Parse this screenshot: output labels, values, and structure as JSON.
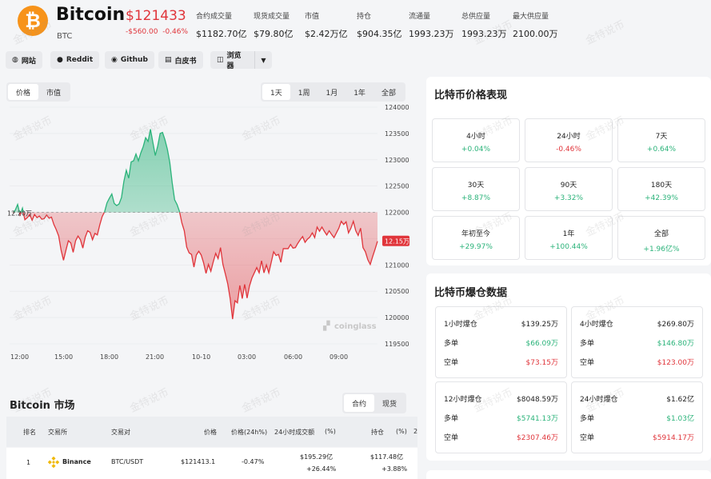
{
  "coin": {
    "logo_glyph": "₿",
    "name": "Bitcoin",
    "symbol": "BTC",
    "price": "$121433",
    "change_abs": "-$560.00",
    "change_pct": "-0.46%"
  },
  "stats": [
    {
      "label": "合约成交量",
      "value": "$1182.70亿"
    },
    {
      "label": "现货成交量",
      "value": "$79.80亿"
    },
    {
      "label": "市值",
      "value": "$2.42万亿"
    },
    {
      "label": "持仓",
      "value": "$904.35亿"
    },
    {
      "label": "流通量",
      "value": "1993.23万"
    },
    {
      "label": "总供应量",
      "value": "1993.23万"
    },
    {
      "label": "最大供应量",
      "value": "2100.00万"
    }
  ],
  "links": [
    {
      "label": "网站",
      "icon": "globe-icon",
      "glyph": "◍"
    },
    {
      "label": "Reddit",
      "icon": "reddit-icon",
      "glyph": "●"
    },
    {
      "label": "Github",
      "icon": "github-icon",
      "glyph": "◉"
    },
    {
      "label": "白皮书",
      "icon": "document-icon",
      "glyph": "▤"
    },
    {
      "label": "浏览器",
      "icon": "browser-icon",
      "glyph": "◫"
    }
  ],
  "chart_tabs": {
    "type_tabs": [
      "价格",
      "市值"
    ],
    "active_type": "价格",
    "range_tabs": [
      "1天",
      "1周",
      "1月",
      "1年",
      "全部"
    ],
    "active_range": "1天"
  },
  "chart_data": {
    "type": "area",
    "title": "",
    "xlabel": "",
    "ylabel": "",
    "x_ticks": [
      "12:00",
      "15:00",
      "18:00",
      "21:00",
      "10-10",
      "03:00",
      "06:00",
      "09:00"
    ],
    "y_ticks": [
      "124000",
      "123500",
      "123000",
      "122500",
      "122000",
      "121500",
      "121000",
      "120500",
      "120000",
      "119500"
    ],
    "ylim": [
      119500,
      124000
    ],
    "baseline": 122000,
    "baseline_label": "12.20万",
    "current_label": "12.15万",
    "watermark": "coinglass",
    "colors": {
      "up": "#2bb37a",
      "down": "#e0353b"
    },
    "series": [
      {
        "values": [
          121990,
          122040,
          122150,
          121950,
          122080,
          121860,
          121900,
          121960,
          121850,
          121960,
          121900,
          121930,
          121870,
          121880,
          121950,
          121890,
          121910,
          121770,
          121670,
          121550,
          121280,
          121090,
          121280,
          121460,
          121420,
          121240,
          121460,
          121550,
          121480,
          121320,
          121530,
          121650,
          121620,
          121480,
          121600,
          121570,
          121760,
          121920,
          122010,
          122180,
          122270,
          122350,
          122170,
          122130,
          122160,
          122280,
          122590,
          122800,
          122650,
          122960,
          122980,
          123110,
          122980,
          123130,
          123250,
          123420,
          123350,
          123580,
          123330,
          123080,
          123260,
          123500,
          123520,
          123380,
          123200,
          122950,
          122560,
          122240,
          122150,
          122020,
          121800,
          121650,
          121340,
          121230,
          121200,
          120960,
          121190,
          121260,
          121190,
          121040,
          120840,
          121010,
          120880,
          121060,
          121220,
          121120,
          121330,
          121010,
          120830,
          120640,
          120360,
          119970,
          120320,
          120280,
          120610,
          120360,
          120630,
          120370,
          120600,
          120750,
          120850,
          120950,
          120850,
          121080,
          120850,
          121000,
          120850,
          121050,
          121250,
          121180,
          121200,
          121050,
          121310,
          121310,
          121310,
          121390,
          121320,
          121330,
          121410,
          121480,
          121540,
          121430,
          121490,
          121530,
          121610,
          121520,
          121720,
          121640,
          121720,
          121640,
          121570,
          121650,
          121580,
          121520,
          121610,
          121700,
          121830,
          121770,
          121820,
          121610,
          121700,
          121830,
          121650,
          121560,
          121700,
          121330,
          121250,
          121100,
          121010,
          121160,
          121300,
          121450
        ]
      }
    ]
  },
  "markets": {
    "title": "Bitcoin 市场",
    "tabs": [
      "合约",
      "现货"
    ],
    "active_tab": "合约",
    "headers": [
      "排名",
      "交易所",
      "交易对",
      "价格",
      "价格(24h%)",
      "24小时成交额",
      "(%)",
      "持仓",
      "(%)",
      "2"
    ],
    "rows": [
      {
        "rank": "1",
        "exchange": "Binance",
        "pair": "BTC/USDT",
        "price": "$121413.1",
        "change": "-0.47%",
        "volume": "$195.29亿",
        "volume_pct": "+26.44%",
        "oi": "$117.48亿",
        "oi_pct": "+3.88%"
      }
    ]
  },
  "performance": {
    "title": "比特币价格表现",
    "cells": [
      {
        "label": "4小时",
        "value": "+0.04%",
        "dir": "up"
      },
      {
        "label": "24小时",
        "value": "-0.46%",
        "dir": "down"
      },
      {
        "label": "7天",
        "value": "+0.64%",
        "dir": "up"
      },
      {
        "label": "30天",
        "value": "+8.87%",
        "dir": "up"
      },
      {
        "label": "90天",
        "value": "+3.32%",
        "dir": "up"
      },
      {
        "label": "180天",
        "value": "+42.39%",
        "dir": "up"
      },
      {
        "label": "年初至今",
        "value": "+29.97%",
        "dir": "up"
      },
      {
        "label": "1年",
        "value": "+100.44%",
        "dir": "up"
      },
      {
        "label": "全部",
        "value": "+1.96亿%",
        "dir": "up"
      }
    ]
  },
  "liquidation": {
    "title": "比特币爆仓数据",
    "long_label": "多单",
    "short_label": "空单",
    "boxes": [
      {
        "label": "1小时爆仓",
        "total": "$139.25万",
        "long": "$66.09万",
        "short": "$73.15万"
      },
      {
        "label": "4小时爆仓",
        "total": "$269.80万",
        "long": "$146.80万",
        "short": "$123.00万"
      },
      {
        "label": "12小时爆仓",
        "total": "$8048.59万",
        "long": "$5741.13万",
        "short": "$2307.46万"
      },
      {
        "label": "24小时爆仓",
        "total": "$1.62亿",
        "long": "$1.03亿",
        "short": "$5914.17万"
      }
    ]
  },
  "watermark_text": "金特说币"
}
